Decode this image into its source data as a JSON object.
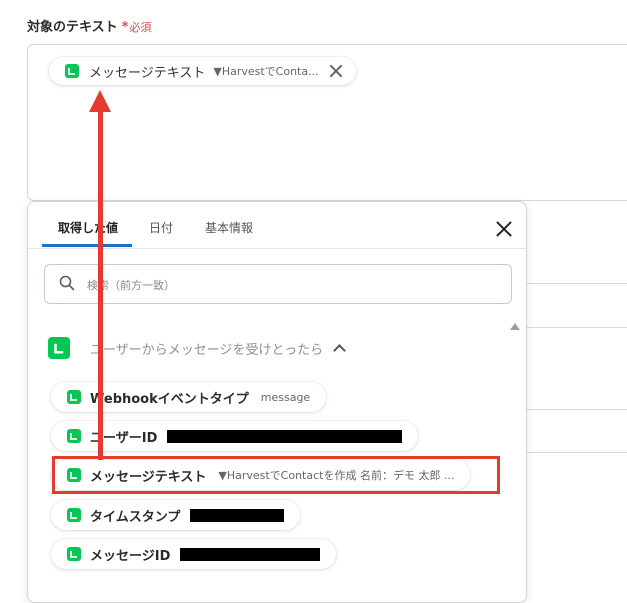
{
  "field": {
    "label": "対象のテキスト",
    "required_star": "*",
    "required_text": "必須"
  },
  "selected_chip": {
    "name": "メッセージテキスト",
    "meta": "▼HarvestでConta..."
  },
  "panel": {
    "tabs": [
      "取得した値",
      "日付",
      "基本情報"
    ],
    "active_tab": "取得した値",
    "search_placeholder": "検索（前方一致）",
    "section_label": "ユーザーからメッセージを受けとったら",
    "items": [
      {
        "name": "Webhookイベントタイプ",
        "meta": "message"
      },
      {
        "name": "ユーザーID",
        "meta": ""
      },
      {
        "name": "メッセージテキスト",
        "meta": "▼HarvestでContactを作成 名前：デモ 太郎 ..."
      },
      {
        "name": "タイムスタンプ",
        "meta": ""
      },
      {
        "name": "メッセージID",
        "meta": ""
      }
    ]
  },
  "colors": {
    "accent": "#1a73c8",
    "line_green": "#06c755",
    "required": "#e5484d",
    "annotation_red": "#e53b2e"
  },
  "icons": [
    "line-app-icon",
    "close-icon",
    "search-icon",
    "chevron-up-icon",
    "scroll-up-icon"
  ]
}
